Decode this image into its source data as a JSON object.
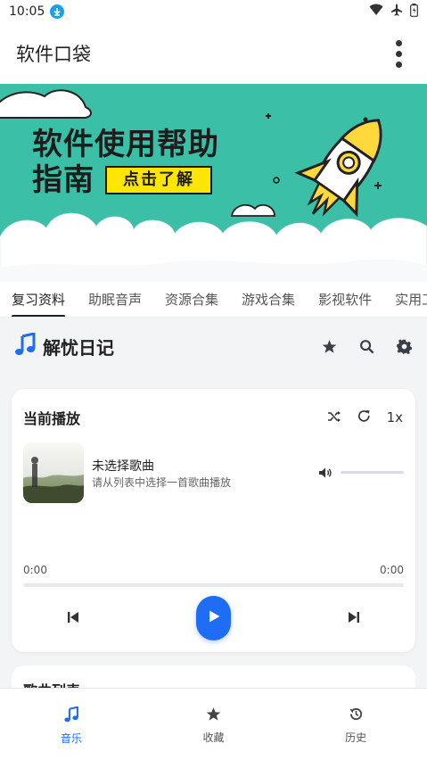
{
  "status_bar": {
    "time": "10:05"
  },
  "app_bar": {
    "title": "软件口袋"
  },
  "banner": {
    "headline_line1": "软件使用帮助",
    "headline_line2": "指南",
    "cta": "点击了解"
  },
  "tabs": [
    {
      "label": "复习资料",
      "active": true
    },
    {
      "label": "助眠音声"
    },
    {
      "label": "资源合集"
    },
    {
      "label": "游戏合集"
    },
    {
      "label": "影视软件"
    },
    {
      "label": "实用工"
    }
  ],
  "section": {
    "title": "解忧日记"
  },
  "player": {
    "title": "当前播放",
    "speed": "1x",
    "song_title": "未选择歌曲",
    "song_subtitle": "请从列表中选择一首歌曲播放",
    "time_current": "0:00",
    "time_total": "0:00",
    "progress": 0,
    "volume": 0
  },
  "song_list": {
    "title": "歌曲列表"
  },
  "bottom_nav": [
    {
      "label": "音乐",
      "icon": "music-note-icon",
      "active": true
    },
    {
      "label": "收藏",
      "icon": "star-icon"
    },
    {
      "label": "历史",
      "icon": "history-icon"
    }
  ],
  "colors": {
    "accent": "#1f6cf5",
    "banner": "#3bbfa6",
    "cta": "#ffe600"
  }
}
